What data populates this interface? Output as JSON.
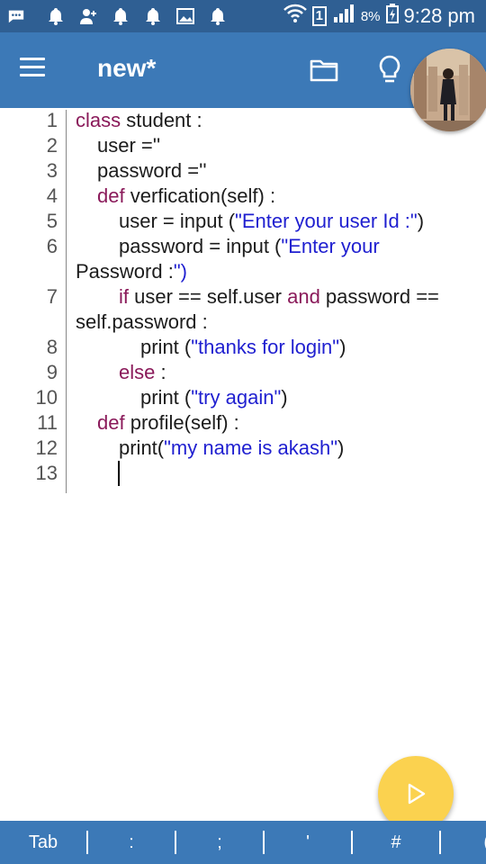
{
  "status_bar": {
    "battery_percent": "8%",
    "time": "9:28 pm",
    "sim_label": "1"
  },
  "app_bar": {
    "title": "new*"
  },
  "editor": {
    "line_numbers": [
      "1",
      "2",
      "3",
      "4",
      "5",
      "6",
      "7",
      "8",
      "9",
      "10",
      "11",
      "12",
      "13"
    ],
    "lines": [
      "class student :",
      "user =''",
      "password =''",
      "def verfication(self) :",
      "user = input (\"Enter your user Id :\")",
      "password = input (\"Enter your",
      "Password :\")",
      "if user == self.user and password ==",
      "self.password :",
      "print (\"thanks for login\")",
      "else :",
      "print (\"try again\")",
      "def profile(self) :",
      "print(\"my name is akash\")"
    ]
  },
  "bottom_keys": [
    "Tab",
    ":",
    ";",
    "'",
    "#",
    "("
  ],
  "colors": {
    "status_bar": "#2f5f93",
    "app_bar": "#3c79b7",
    "keyword": "#8a1a5a",
    "string": "#1f1fd0",
    "fab": "#fbd24f"
  }
}
